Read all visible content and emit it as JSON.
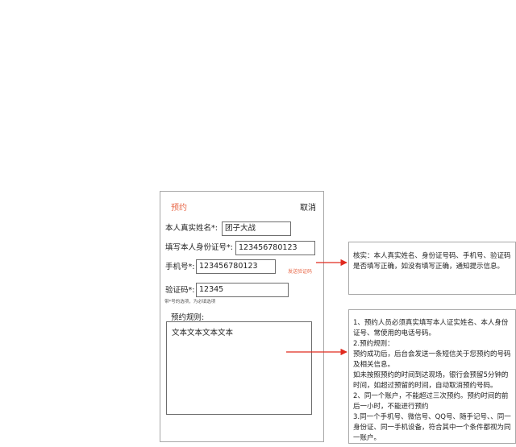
{
  "header": {
    "title": "预约",
    "cancel_label": "取消"
  },
  "form": {
    "name_label": "本人真实姓名*:",
    "name_value": "团子大战",
    "id_label": "填写本人身份证号*:",
    "id_value": "123456780123",
    "phone_label": "手机号*:",
    "phone_value": "123456780123",
    "send_code_label": "发送验证码",
    "code_label": "验证码*:",
    "code_value": "12345",
    "required_hint": "带*号的选项，为必填选项"
  },
  "rules": {
    "label": "预约规则:",
    "content": "文本文本文本文本"
  },
  "annotations": {
    "verify_note": "核实：本人真实姓名、身份证号码、手机号、验证码是否填写正确，如没有填写正确，通知提示信息。",
    "rules_note": [
      "1、预约人员必须真实填写本人证实姓名、本人身份证号、常使用的电话号码。",
      "2.预约规则：",
      "预约成功后，后台会发送一条短信关于您预约的号码及相关信息。",
      "如未按照预约的时间到达现场，银行会预留5分钟的时间，如超过预留的时间，自动取消预约号码。",
      "2、同一个账户，不能超过三次预约。预约时间的前后一小时，不能进行预约",
      "3.同一个手机号、微信号、QQ号、随手记号、、同一身份证、同一手机设备，符合其中一个条件都视为同一账户。"
    ]
  },
  "colors": {
    "accent": "#e8694a",
    "arrow": "#e02a1f",
    "border": "#a8a8a8"
  }
}
